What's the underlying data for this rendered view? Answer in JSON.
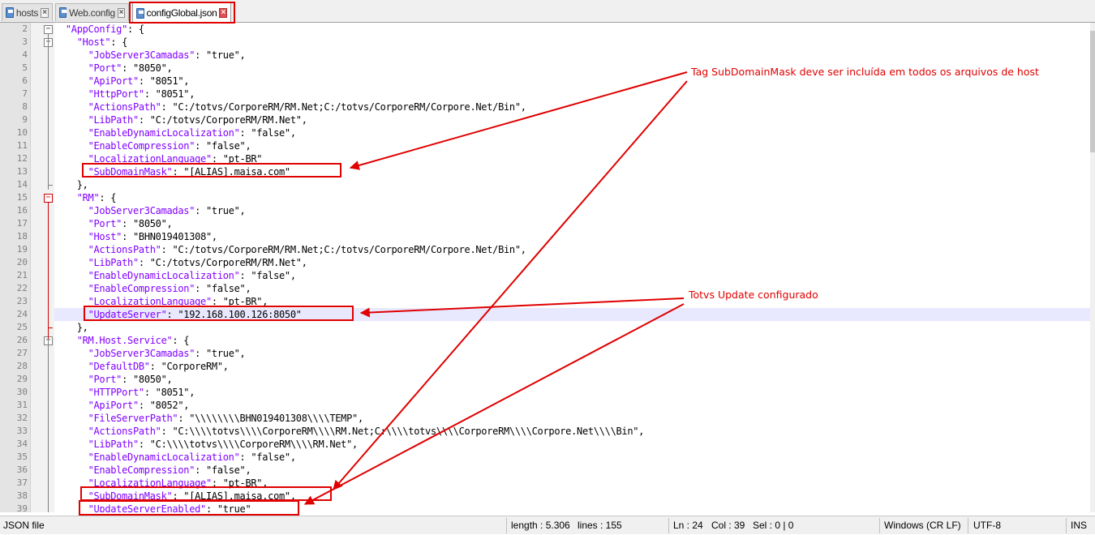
{
  "tabs": [
    {
      "label": "hosts",
      "active": false
    },
    {
      "label": "Web.config",
      "active": false
    },
    {
      "label": "configGlobal.json",
      "active": true
    }
  ],
  "editor": {
    "lines": [
      {
        "n": "2",
        "text": "  \"AppConfig\": {"
      },
      {
        "n": "3",
        "text": "    \"Host\": {"
      },
      {
        "n": "4",
        "text": "      \"JobServer3Camadas\": \"true\","
      },
      {
        "n": "5",
        "text": "      \"Port\": \"8050\","
      },
      {
        "n": "6",
        "text": "      \"ApiPort\": \"8051\","
      },
      {
        "n": "7",
        "text": "      \"HttpPort\": \"8051\","
      },
      {
        "n": "8",
        "text": "      \"ActionsPath\": \"C:/totvs/CorporeRM/RM.Net;C:/totvs/CorporeRM/Corpore.Net/Bin\","
      },
      {
        "n": "9",
        "text": "      \"LibPath\": \"C:/totvs/CorporeRM/RM.Net\","
      },
      {
        "n": "10",
        "text": "      \"EnableDynamicLocalization\": \"false\","
      },
      {
        "n": "11",
        "text": "      \"EnableCompression\": \"false\","
      },
      {
        "n": "12",
        "text": "      \"LocalizationLanguage\": \"pt-BR\""
      },
      {
        "n": "13",
        "text": "      \"SubDomainMask\": \"[ALIAS].maisa.com\""
      },
      {
        "n": "14",
        "text": "    },"
      },
      {
        "n": "15",
        "text": "    \"RM\": {"
      },
      {
        "n": "16",
        "text": "      \"JobServer3Camadas\": \"true\","
      },
      {
        "n": "17",
        "text": "      \"Port\": \"8050\","
      },
      {
        "n": "18",
        "text": "      \"Host\": \"BHN019401308\","
      },
      {
        "n": "19",
        "text": "      \"ActionsPath\": \"C:/totvs/CorporeRM/RM.Net;C:/totvs/CorporeRM/Corpore.Net/Bin\","
      },
      {
        "n": "20",
        "text": "      \"LibPath\": \"C:/totvs/CorporeRM/RM.Net\","
      },
      {
        "n": "21",
        "text": "      \"EnableDynamicLocalization\": \"false\","
      },
      {
        "n": "22",
        "text": "      \"EnableCompression\": \"false\","
      },
      {
        "n": "23",
        "text": "      \"LocalizationLanguage\": \"pt-BR\","
      },
      {
        "n": "24",
        "text": "      \"UpdateServer\": \"192.168.100.126:8050\""
      },
      {
        "n": "25",
        "text": "    },"
      },
      {
        "n": "26",
        "text": "    \"RM.Host.Service\": {"
      },
      {
        "n": "27",
        "text": "      \"JobServer3Camadas\": \"true\","
      },
      {
        "n": "28",
        "text": "      \"DefaultDB\": \"CorporeRM\","
      },
      {
        "n": "29",
        "text": "      \"Port\": \"8050\","
      },
      {
        "n": "30",
        "text": "      \"HTTPPort\": \"8051\","
      },
      {
        "n": "31",
        "text": "      \"ApiPort\": \"8052\","
      },
      {
        "n": "32",
        "text": "      \"FileServerPath\": \"\\\\\\\\\\\\\\\\BHN019401308\\\\\\\\TEMP\","
      },
      {
        "n": "33",
        "text": "      \"ActionsPath\": \"C:\\\\\\\\totvs\\\\\\\\CorporeRM\\\\\\\\RM.Net;C:\\\\\\\\totvs\\\\\\\\CorporeRM\\\\\\\\Corpore.Net\\\\\\\\Bin\","
      },
      {
        "n": "34",
        "text": "      \"LibPath\": \"C:\\\\\\\\totvs\\\\\\\\CorporeRM\\\\\\\\RM.Net\","
      },
      {
        "n": "35",
        "text": "      \"EnableDynamicLocalization\": \"false\","
      },
      {
        "n": "36",
        "text": "      \"EnableCompression\": \"false\","
      },
      {
        "n": "37",
        "text": "      \"LocalizationLanguage\": \"pt-BR\","
      },
      {
        "n": "38",
        "text": "      \"SubDomainMask\": \"[ALIAS].maisa.com\","
      },
      {
        "n": "39",
        "text": "      \"UpdateServerEnabled\": \"true\""
      }
    ],
    "highlighted_line": "24"
  },
  "annotations": {
    "subdomain_note": "Tag SubDomainMask deve ser incluída em todos os arquivos de host",
    "update_note": "Totvs Update configurado",
    "color": "#e00000"
  },
  "statusbar": {
    "file_type": "JSON file",
    "length": "length : 5.306",
    "lines": "lines : 155",
    "ln": "Ln : 24",
    "col": "Col : 39",
    "sel": "Sel : 0 | 0",
    "eol": "Windows (CR LF)",
    "encoding": "UTF-8",
    "mode": "INS"
  }
}
